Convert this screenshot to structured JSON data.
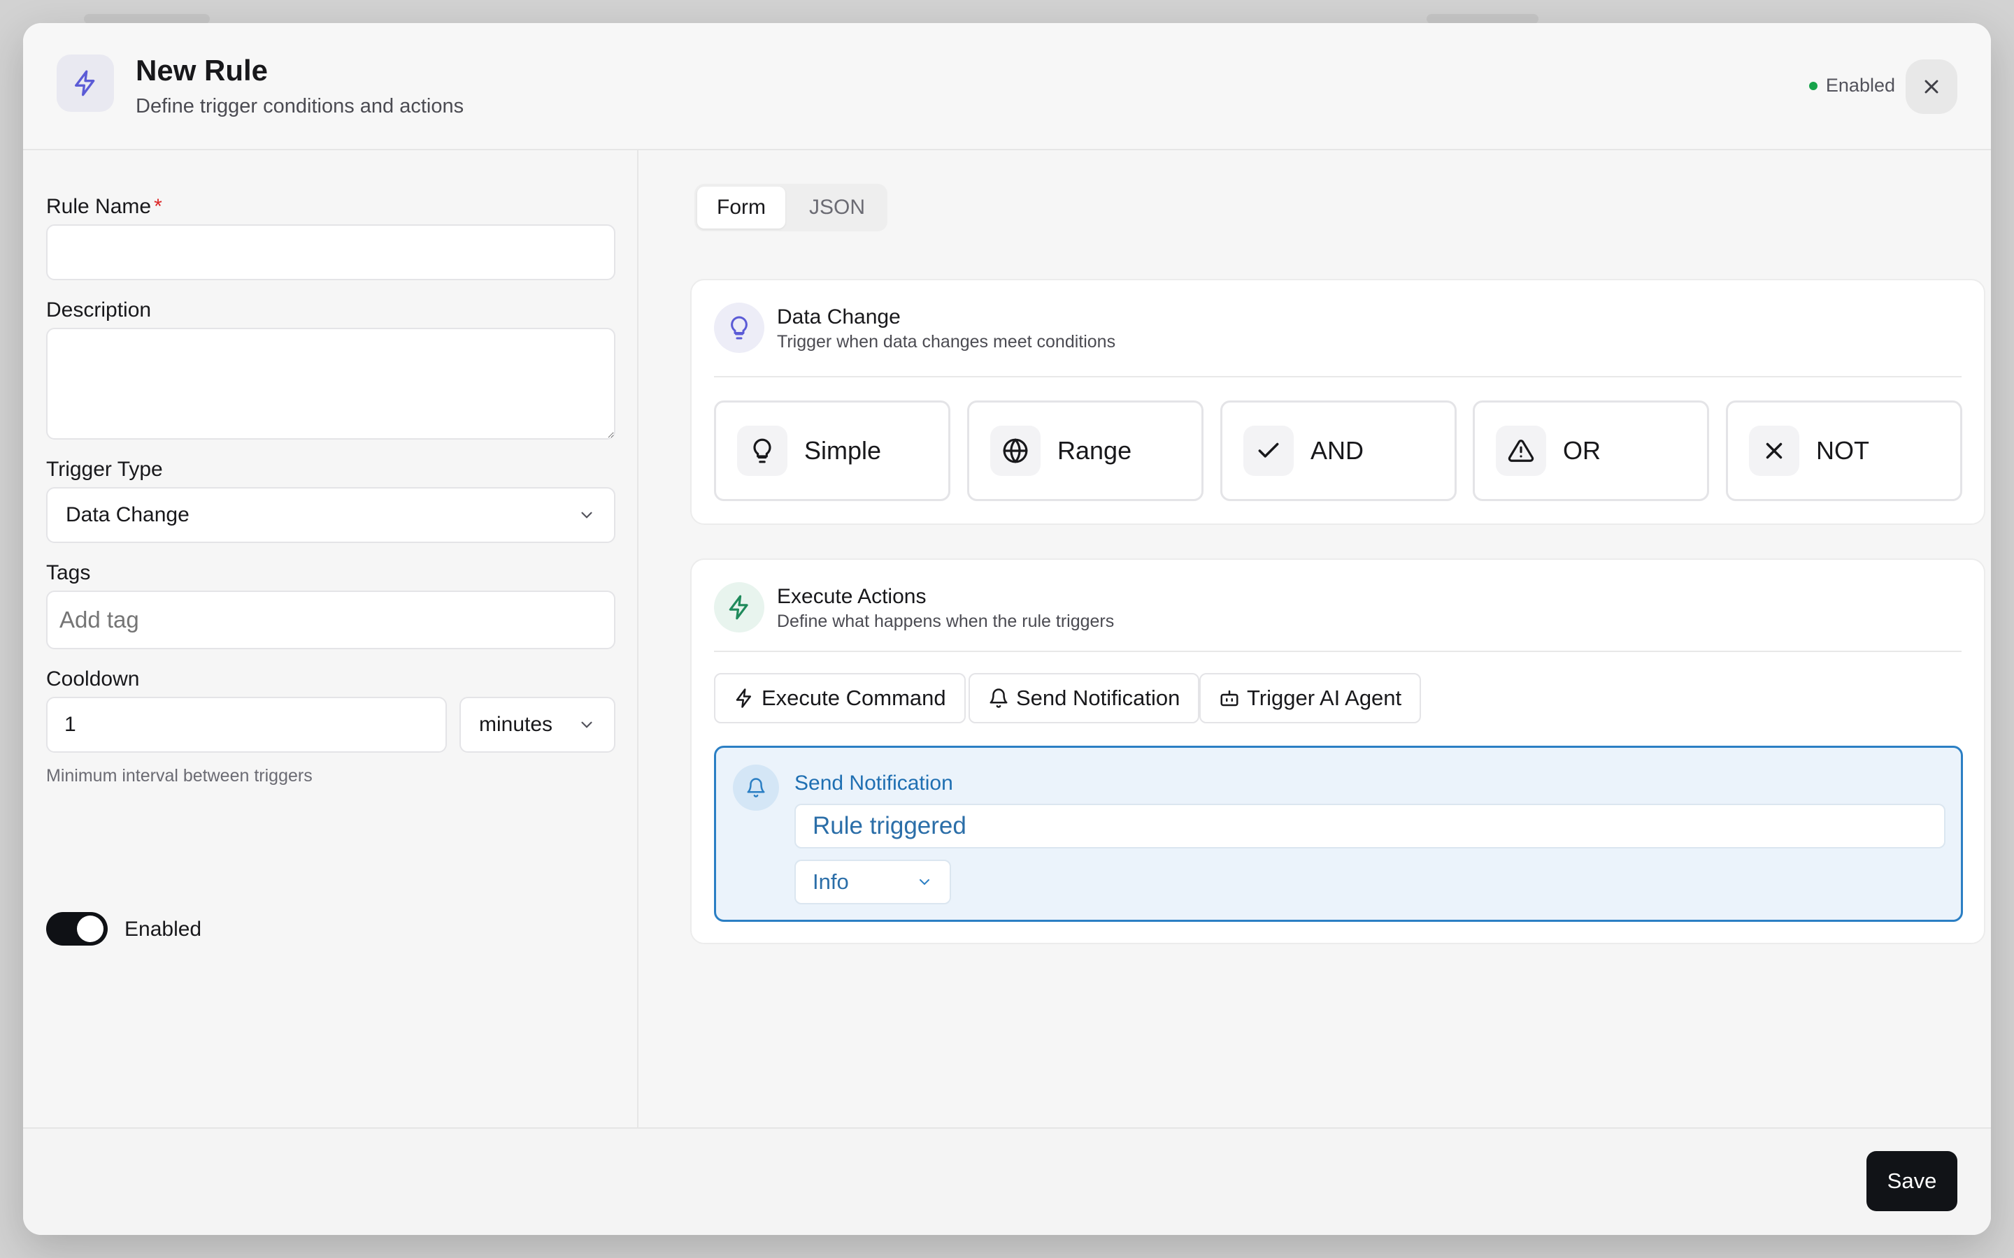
{
  "header": {
    "title": "New Rule",
    "subtitle": "Define trigger conditions and actions",
    "status": "Enabled"
  },
  "form": {
    "rule_name_label": "Rule Name",
    "rule_name_required": "*",
    "rule_name_value": "",
    "description_label": "Description",
    "description_value": "",
    "trigger_type_label": "Trigger Type",
    "trigger_type_value": "Data Change",
    "tags_label": "Tags",
    "tags_placeholder": "Add tag",
    "cooldown_label": "Cooldown",
    "cooldown_value": "1",
    "cooldown_unit": "minutes",
    "cooldown_hint": "Minimum interval between triggers",
    "enabled_label": "Enabled"
  },
  "tabs": [
    {
      "label": "Form",
      "active": true
    },
    {
      "label": "JSON",
      "active": false
    }
  ],
  "trigger_card": {
    "title": "Data Change",
    "subtitle": "Trigger when data changes meet conditions",
    "conditions": [
      {
        "label": "Simple",
        "icon": "lightbulb-icon"
      },
      {
        "label": "Range",
        "icon": "globe-icon"
      },
      {
        "label": "AND",
        "icon": "check-icon"
      },
      {
        "label": "OR",
        "icon": "warning-icon"
      },
      {
        "label": "NOT",
        "icon": "x-icon"
      }
    ]
  },
  "actions_card": {
    "title": "Execute Actions",
    "subtitle": "Define what happens when the rule triggers",
    "buttons": [
      {
        "label": "Execute Command",
        "icon": "bolt-icon"
      },
      {
        "label": "Send Notification",
        "icon": "bell-icon"
      },
      {
        "label": "Trigger AI Agent",
        "icon": "robot-icon"
      }
    ],
    "notification": {
      "title": "Send Notification",
      "message": "Rule triggered",
      "level": "Info"
    }
  },
  "footer": {
    "save_label": "Save"
  },
  "colors": {
    "accent_purple": "#5b5bd6",
    "accent_green": "#1f8a5b",
    "notification_blue": "#2b7fc4",
    "status_green": "#16a34a",
    "primary_button": "#111317"
  }
}
